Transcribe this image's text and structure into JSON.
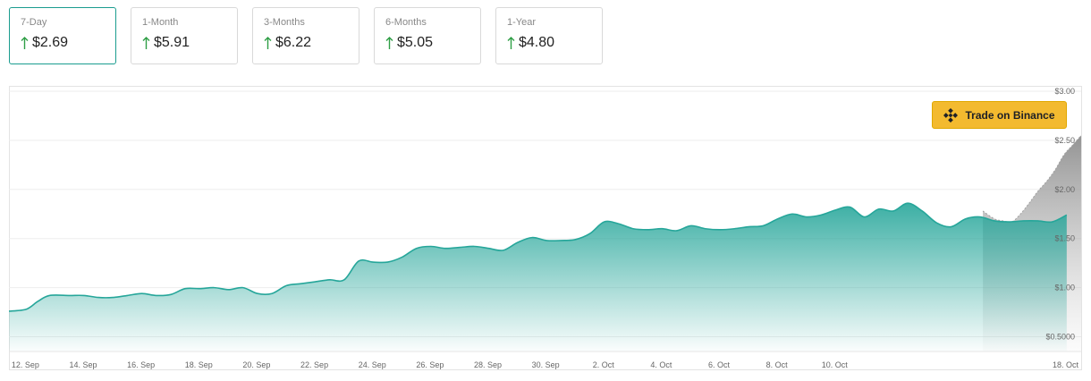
{
  "cards": [
    {
      "label": "7-Day",
      "value": "$2.69"
    },
    {
      "label": "1-Month",
      "value": "$5.91"
    },
    {
      "label": "3-Months",
      "value": "$6.22"
    },
    {
      "label": "6-Months",
      "value": "$5.05"
    },
    {
      "label": "1-Year",
      "value": "$4.80"
    }
  ],
  "trade_button": {
    "label": "Trade on Binance"
  },
  "colors": {
    "accent": "#1a9c8f",
    "line": "#26a69a",
    "arrow_up": "#2e9e45",
    "binance": "#f3ba2f",
    "forecast": "#9e9e9e"
  },
  "chart_data": {
    "type": "area",
    "y_tick_labels": [
      "$0.5000",
      "$1.00",
      "$1.50",
      "$2.00",
      "$2.50",
      "$3.00"
    ],
    "y_tick_values": [
      0.5,
      1.0,
      1.5,
      2.0,
      2.5,
      3.0
    ],
    "x_tick_labels": [
      "12. Sep",
      "14. Sep",
      "16. Sep",
      "18. Sep",
      "20. Sep",
      "22. Sep",
      "24. Sep",
      "26. Sep",
      "28. Sep",
      "30. Sep",
      "2. Oct",
      "4. Oct",
      "6. Oct",
      "8. Oct",
      "10. Oct",
      "18. Oct"
    ],
    "ylim": [
      0.35,
      3.0
    ],
    "x_range_days": [
      -0.6,
      36.5
    ],
    "series": [
      {
        "x": [
          -0.6,
          0,
          0.4,
          0.8,
          1.5,
          2,
          2.5,
          3,
          3.5,
          4,
          4.5,
          5,
          5.5,
          6,
          6.5,
          7,
          7.5,
          8,
          8.5,
          9,
          9.5,
          10,
          10.5,
          11,
          11.5,
          12,
          12.5,
          13,
          13.5,
          14,
          14.5,
          15,
          15.5,
          16,
          16.5,
          17,
          17.5,
          18,
          18.5,
          19,
          19.5,
          20,
          20.5,
          21,
          21.5,
          22,
          22.5,
          23,
          23.5,
          24,
          24.5,
          25,
          25.5,
          26,
          26.5,
          27,
          27.5,
          28,
          28.5,
          29,
          29.5,
          30,
          30.5,
          31,
          31.5,
          32,
          32.5,
          33,
          33.5,
          34,
          34.5,
          35,
          35.5,
          36
        ],
        "y": [
          0.76,
          0.78,
          0.86,
          0.92,
          0.92,
          0.92,
          0.9,
          0.9,
          0.92,
          0.94,
          0.92,
          0.93,
          0.99,
          0.99,
          1.0,
          0.98,
          1.0,
          0.94,
          0.94,
          1.02,
          1.04,
          1.06,
          1.08,
          1.08,
          1.27,
          1.26,
          1.26,
          1.31,
          1.4,
          1.42,
          1.4,
          1.41,
          1.42,
          1.4,
          1.38,
          1.46,
          1.51,
          1.48,
          1.48,
          1.49,
          1.55,
          1.67,
          1.65,
          1.6,
          1.59,
          1.6,
          1.58,
          1.63,
          1.6,
          1.59,
          1.6,
          1.62,
          1.63,
          1.7,
          1.75,
          1.72,
          1.74,
          1.79,
          1.82,
          1.72,
          1.8,
          1.78,
          1.86,
          1.78,
          1.66,
          1.62,
          1.7,
          1.72,
          1.68,
          1.67,
          1.68,
          1.68,
          1.67,
          1.74
        ]
      }
    ],
    "forecast": {
      "x": [
        33.1,
        33.5,
        33.8,
        34.1,
        34.4,
        34.7,
        35.0,
        35.3,
        35.6,
        35.9,
        36.2,
        36.5
      ],
      "y": [
        1.78,
        1.7,
        1.68,
        1.67,
        1.75,
        1.86,
        1.98,
        2.08,
        2.2,
        2.35,
        2.45,
        2.55
      ]
    }
  }
}
